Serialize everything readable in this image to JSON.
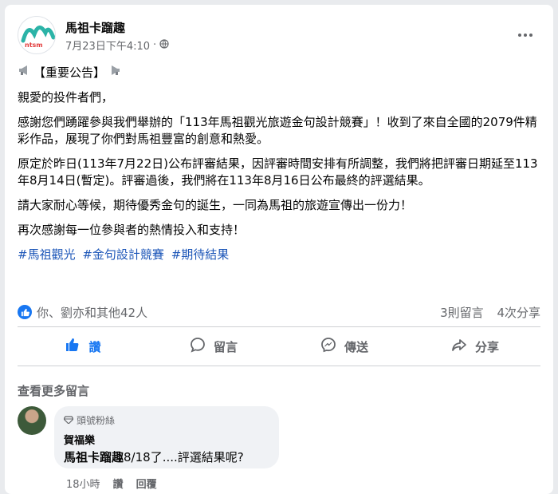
{
  "post": {
    "page_name": "馬祖卡蹓趣",
    "timestamp": "7月23日下午4:10",
    "separator": "·",
    "announcement": "【重要公告】",
    "greeting": "親愛的投件者們，",
    "paragraph1": "感謝您們踴躍參與我們舉辦的「113年馬祖觀光旅遊金句設計競賽」！收到了來自全國的2079件精彩作品，展現了你們對馬祖豐富的創意和熱愛。",
    "paragraph2": "原定於昨日(113年7月22日)公布評審結果，因評審時間安排有所調整，我們將把評審日期延至113年8月14日(暫定)。評審過後，我們將在113年8月16日公布最終的評選結果。",
    "paragraph3": "請大家耐心等候，期待優秀金句的誕生，一同為馬祖的旅遊宣傳出一份力！",
    "paragraph4": "再次感謝每一位參與者的熱情投入和支持！",
    "hashtags": [
      "#馬祖觀光",
      "#金句設計競賽",
      "#期待結果"
    ]
  },
  "stats": {
    "reactions_text": "你、劉亦和其他42人",
    "comments": "3則留言",
    "shares": "4次分享"
  },
  "actions": {
    "like": "讚",
    "comment": "留言",
    "send": "傳送",
    "share": "分享"
  },
  "comments_section": {
    "more_comments": "查看更多留言",
    "comment": {
      "badge": "頭號粉絲",
      "author": "賀福樂",
      "mention": "馬祖卡蹓趣",
      "text": "8/18了....評選結果呢?",
      "time": "18小時",
      "like": "讚",
      "reply": "回覆"
    }
  },
  "colors": {
    "accent": "#1877f2",
    "hashtag": "#1c56b8",
    "secondary_text": "#65676b"
  }
}
